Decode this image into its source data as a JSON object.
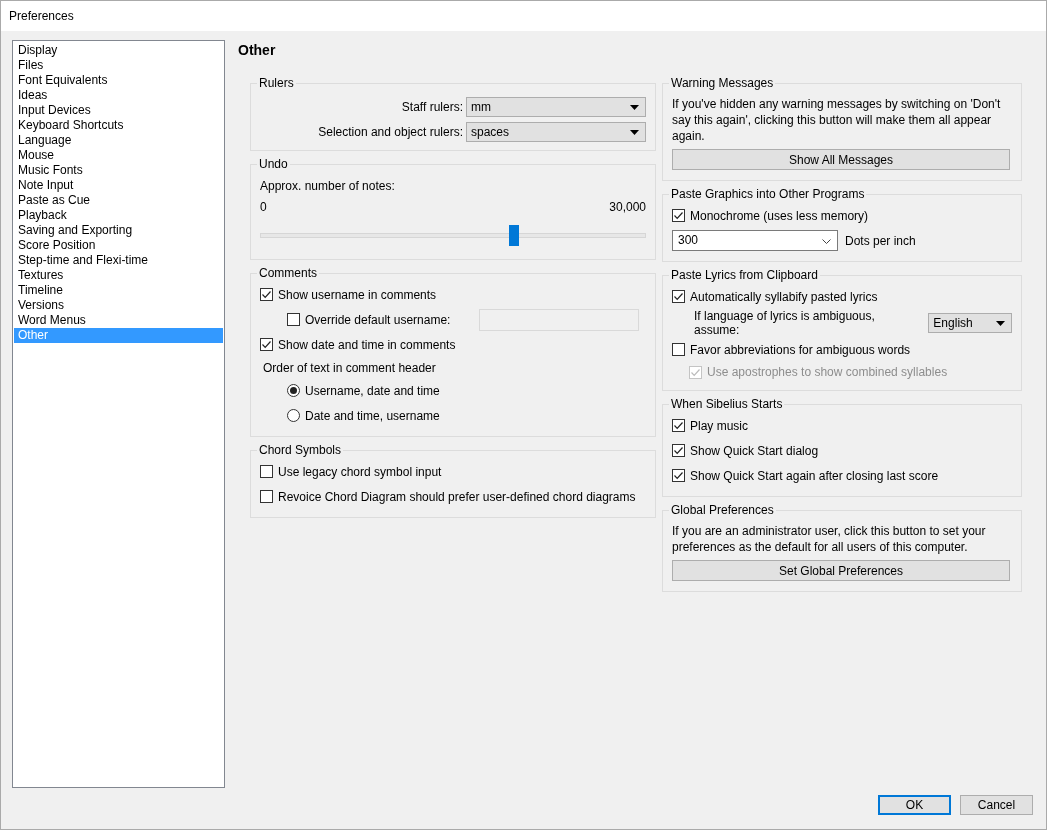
{
  "window": {
    "title": "Preferences"
  },
  "sidebar": {
    "items": [
      {
        "label": "Display",
        "selected": false
      },
      {
        "label": "Files",
        "selected": false
      },
      {
        "label": "Font Equivalents",
        "selected": false
      },
      {
        "label": "Ideas",
        "selected": false
      },
      {
        "label": "Input Devices",
        "selected": false
      },
      {
        "label": "Keyboard Shortcuts",
        "selected": false
      },
      {
        "label": "Language",
        "selected": false
      },
      {
        "label": "Mouse",
        "selected": false
      },
      {
        "label": "Music Fonts",
        "selected": false
      },
      {
        "label": "Note Input",
        "selected": false
      },
      {
        "label": "Paste as Cue",
        "selected": false
      },
      {
        "label": "Playback",
        "selected": false
      },
      {
        "label": "Saving and Exporting",
        "selected": false
      },
      {
        "label": "Score Position",
        "selected": false
      },
      {
        "label": "Step-time and Flexi-time",
        "selected": false
      },
      {
        "label": "Textures",
        "selected": false
      },
      {
        "label": "Timeline",
        "selected": false
      },
      {
        "label": "Versions",
        "selected": false
      },
      {
        "label": "Word Menus",
        "selected": false
      },
      {
        "label": "Other",
        "selected": true
      }
    ]
  },
  "page_title": "Other",
  "rulers": {
    "title": "Rulers",
    "fields": [
      {
        "label": "Staff rulers:",
        "value": "mm"
      },
      {
        "label": "Selection and object rulers:",
        "value": "spaces"
      }
    ]
  },
  "undo": {
    "title": "Undo",
    "label": "Approx. number of notes:",
    "min": "0",
    "max": "30,000",
    "level": 0.66
  },
  "comments": {
    "title": "Comments",
    "show_username": {
      "label": "Show username in comments",
      "checked": true
    },
    "override_username": {
      "label": "Override default username:",
      "checked": false
    },
    "show_date": {
      "label": "Show date and time in comments",
      "checked": true
    },
    "order_label": "Order of text in comment header",
    "order_options": [
      {
        "label": "Username, date and time",
        "selected": true
      },
      {
        "label": "Date and time, username",
        "selected": false
      }
    ]
  },
  "chord_symbols": {
    "title": "Chord Symbols",
    "options": [
      {
        "label": "Use legacy chord symbol input",
        "checked": false
      },
      {
        "label": "Revoice Chord Diagram should prefer user-defined chord diagrams",
        "checked": false
      }
    ]
  },
  "warning_messages": {
    "title": "Warning Messages",
    "text": "If you've hidden any warning messages by switching on 'Don't say this again', clicking this button will make them all appear again.",
    "button": "Show All Messages"
  },
  "paste_graphics": {
    "title": "Paste Graphics into Other Programs",
    "monochrome": {
      "label": "Monochrome (uses less memory)",
      "checked": true
    },
    "dpi": {
      "value": "300",
      "label": "Dots per inch"
    }
  },
  "paste_lyrics": {
    "title": "Paste Lyrics from Clipboard",
    "syllabify": {
      "label": "Automatically syllabify pasted lyrics",
      "checked": true
    },
    "language": {
      "label": "If language of lyrics is ambiguous, assume:",
      "value": "English"
    },
    "favor_abbreviations": {
      "label": "Favor abbreviations for ambiguous words",
      "checked": false
    },
    "apostrophes": {
      "label": "Use apostrophes to show combined syllables",
      "checked": true,
      "disabled": true
    }
  },
  "when_starts": {
    "title": "When Sibelius Starts",
    "options": [
      {
        "label": "Play music",
        "checked": true
      },
      {
        "label": "Show Quick Start dialog",
        "checked": true
      },
      {
        "label": "Show Quick Start again after closing last score",
        "checked": true
      }
    ]
  },
  "global_preferences": {
    "title": "Global Preferences",
    "text": "If you are an administrator user, click this button to set your preferences as the default for all users of this computer.",
    "button": "Set Global Preferences"
  },
  "buttons": [
    {
      "label": "OK",
      "default": true
    },
    {
      "label": "Cancel",
      "default": false
    }
  ]
}
